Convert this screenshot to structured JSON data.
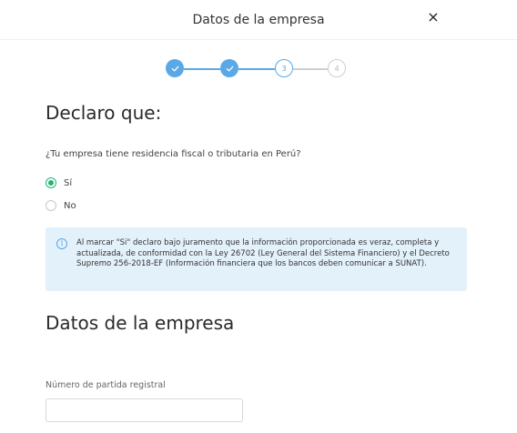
{
  "modal": {
    "title": "Datos de la empresa",
    "close_icon": "×"
  },
  "stepper": {
    "steps": [
      {
        "label": "",
        "state": "done",
        "icon": "check-icon"
      },
      {
        "label": "",
        "state": "done",
        "icon": "check-icon"
      },
      {
        "label": "3",
        "state": "current"
      },
      {
        "label": "4",
        "state": "todo"
      }
    ],
    "colors": {
      "active": "#5aa9e6",
      "inactive": "#cfcfcf"
    }
  },
  "declaration": {
    "heading": "Declaro que:",
    "question": "¿Tu empresa tiene residencia fiscal o tributaria en Perú?",
    "options": [
      {
        "label": "Sí",
        "selected": true
      },
      {
        "label": "No",
        "selected": false
      }
    ],
    "selected_color": "#22b573"
  },
  "info": {
    "icon": "info-icon",
    "text": "Al marcar \"Si\" declaro bajo juramento que la información proporcionada es veraz, completa y actualizada, de conformidad con la Ley 26702 (Ley General del Sistema Financiero) y el Decreto Supremo 256-2018-EF (Información financiera que los bancos deben comunicar a SUNAT).",
    "background": "#e3f1fb"
  },
  "company": {
    "heading": "Datos de la empresa",
    "field_label": "Número de partida registral",
    "field_value": "",
    "field_placeholder": ""
  }
}
